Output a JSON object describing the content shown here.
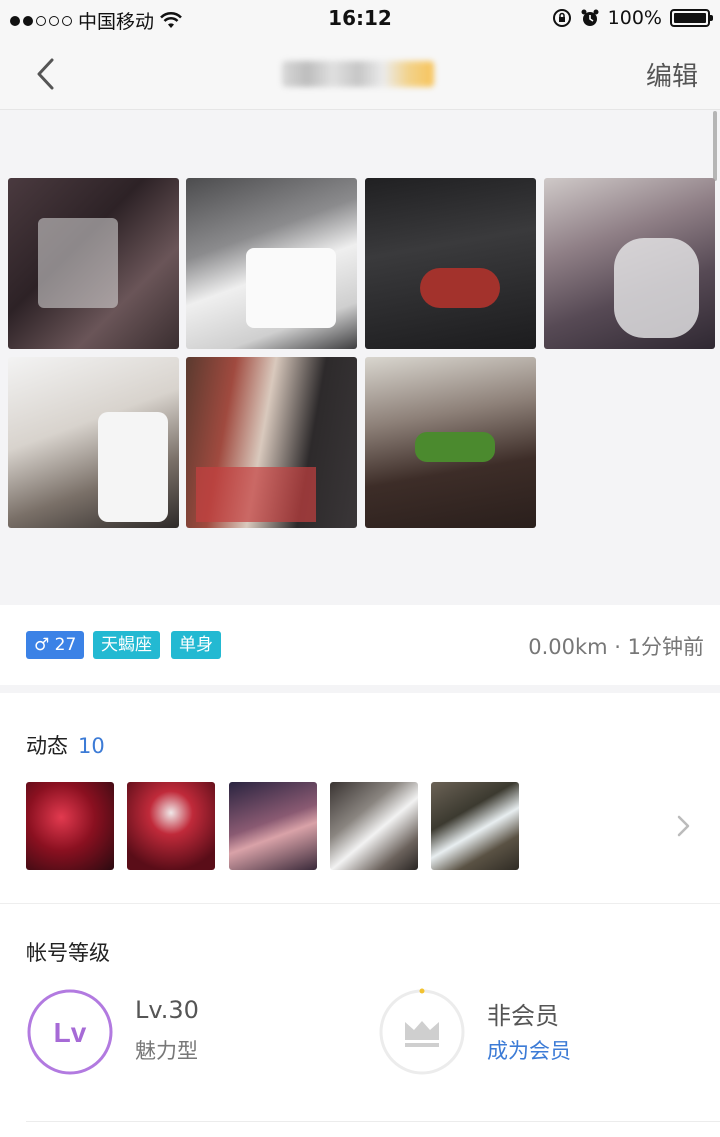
{
  "status_bar": {
    "carrier": "中国移动",
    "time": "16:12",
    "battery": "100%"
  },
  "nav": {
    "edit_label": "编辑"
  },
  "profile": {
    "tags": {
      "gender_age": "♂ 27",
      "zodiac": "天蝎座",
      "relationship": "单身"
    },
    "distance_time": "0.00km · 1分钟前"
  },
  "moments": {
    "title": "动态",
    "count": "10"
  },
  "account_level": {
    "title": "帐号等级",
    "level": "Lv.30",
    "level_type": "魅力型",
    "lv_badge": "Lv",
    "vip_status": "非会员",
    "vip_cta": "成为会员"
  },
  "colors": {
    "accent_blue": "#3c7bd6",
    "tag_blue": "#3b82e6",
    "tag_teal": "#23b9d2",
    "level_purple": "#a66ad6"
  }
}
